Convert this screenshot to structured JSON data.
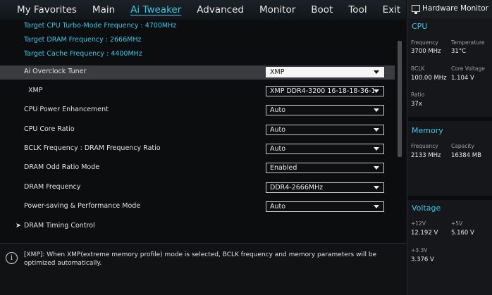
{
  "menu": {
    "items": [
      {
        "label": "My Favorites",
        "active": false
      },
      {
        "label": "Main",
        "active": false
      },
      {
        "label": "Ai Tweaker",
        "active": true
      },
      {
        "label": "Advanced",
        "active": false
      },
      {
        "label": "Monitor",
        "active": false
      },
      {
        "label": "Boot",
        "active": false
      },
      {
        "label": "Tool",
        "active": false
      },
      {
        "label": "Exit",
        "active": false
      }
    ]
  },
  "info": {
    "cpu_turbo": "Target CPU Turbo-Mode Frequency : 4700MHz",
    "dram_freq": "Target DRAM Frequency : 2666MHz",
    "cache_freq": "Target Cache Frequency : 4400MHz"
  },
  "settings": [
    {
      "label": "Ai Overclock Tuner",
      "value": "XMP"
    },
    {
      "label": "XMP",
      "value": "XMP DDR4-3200 16-18-18-36-1."
    },
    {
      "label": "CPU Power Enhancement",
      "value": "Auto"
    },
    {
      "label": "CPU Core Ratio",
      "value": "Auto"
    },
    {
      "label": "BCLK Frequency : DRAM Frequency Ratio",
      "value": "Auto"
    },
    {
      "label": "DRAM Odd Ratio Mode",
      "value": "Enabled"
    },
    {
      "label": "DRAM Frequency",
      "value": "DDR4-2666MHz"
    },
    {
      "label": "Power-saving & Performance Mode",
      "value": "Auto"
    }
  ],
  "submenu": {
    "label": "DRAM Timing Control",
    "arrow": "➤"
  },
  "help": {
    "icon": "i",
    "text": "[XMP]: When XMP(extreme memory profile) mode is selected, BCLK frequency and memory parameters will be optimized automatically."
  },
  "hwmon": {
    "title": "Hardware Monitor",
    "cpu": {
      "title": "CPU",
      "frequency_label": "Frequency",
      "frequency": "3700 MHz",
      "temperature_label": "Temperature",
      "temperature": "31°C",
      "bclk_label": "BCLK",
      "bclk": "100.00 MHz",
      "core_voltage_label": "Core Voltage",
      "core_voltage": "1.104 V",
      "ratio_label": "Ratio",
      "ratio": "37x"
    },
    "memory": {
      "title": "Memory",
      "frequency_label": "Frequency",
      "frequency": "2133 MHz",
      "capacity_label": "Capacity",
      "capacity": "16384 MB"
    },
    "voltage": {
      "title": "Voltage",
      "v12_label": "+12V",
      "v12": "12.192 V",
      "v5_label": "+5V",
      "v5": "5.160 V",
      "v33_label": "+3.3V",
      "v33": "3.376 V"
    }
  },
  "colors": {
    "accent": "#3ec6e8",
    "highlight_row": "#3a3c40",
    "background": "#0c0d0f"
  }
}
